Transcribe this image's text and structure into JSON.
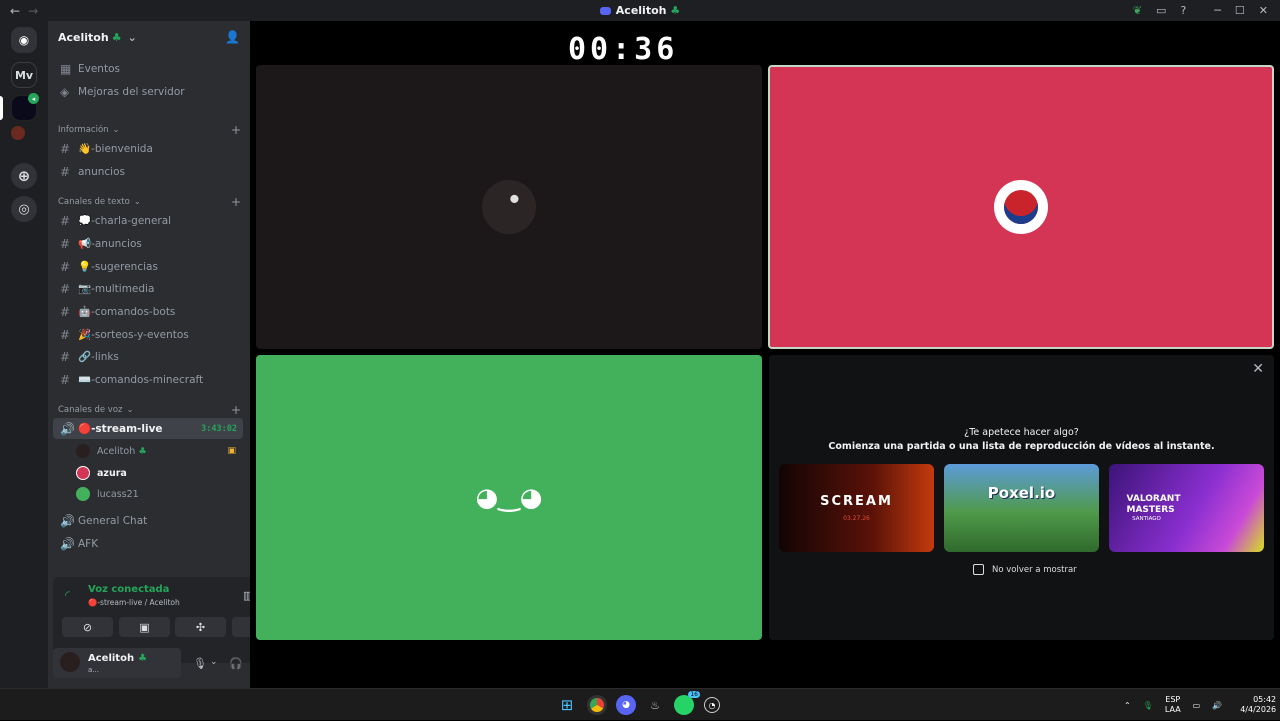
{
  "window": {
    "title": "Acelitoh",
    "back": "←",
    "forward": "→",
    "controls": [
      "─",
      "☐",
      "✕"
    ]
  },
  "server": {
    "name": "Acelitoh",
    "top_items": [
      "Eventos",
      "Mejoras del servidor"
    ],
    "categories": {
      "info": "Información",
      "text": "Canales de texto",
      "voice": "Canales de voz"
    },
    "info_channels": [
      "👋-bienvenida",
      "anuncios"
    ],
    "text_channels": [
      "💭-charla-general",
      "📢-anuncios",
      "💡-sugerencias",
      "📷-multimedia",
      "🤖-comandos-bots",
      "🎉-sorteos-y-eventos",
      "🔗-links",
      "⌨️-comandos-minecraft"
    ],
    "voice_active": {
      "name": "🔴-stream-live",
      "timer": "3:43:02"
    },
    "voice_users": [
      "Acelitoh",
      "azura",
      "lucass21"
    ],
    "voice_other": [
      "General Chat",
      "AFK"
    ]
  },
  "guild_rail": {
    "mv_label": "Mv"
  },
  "voice_panel": {
    "status": "Voz conectada",
    "sub": "🔴-stream-live / Acelitoh"
  },
  "user_panel": {
    "name": "Acelitoh",
    "status": "a..."
  },
  "stage": {
    "timer": "00:36"
  },
  "activity": {
    "question": "¿Te apetece hacer algo?",
    "subtitle": "Comienza una partida o una lista de reproducción de vídeos al instante.",
    "cards": [
      {
        "title": "SCREAM",
        "extra": "03.27.26",
        "color": "#2a0c0a"
      },
      {
        "title": "Poxel.io",
        "extra": "",
        "color": "#3f7f3d"
      },
      {
        "title": "VALORANT MASTERS",
        "extra": "SANTIAGO",
        "color": "#6b2fb5"
      }
    ],
    "checkbox": "No volver a mostrar"
  },
  "taskbar": {
    "lang1": "ESP",
    "lang2": "LAA",
    "time": "05:42",
    "date": "4/4/2026",
    "whatsapp_badge": "16"
  },
  "colors": {
    "tile_dark": "#1c1819",
    "tile_pink": "#d43555",
    "tile_green": "#43b15b",
    "accent_green": "#23a55a"
  }
}
